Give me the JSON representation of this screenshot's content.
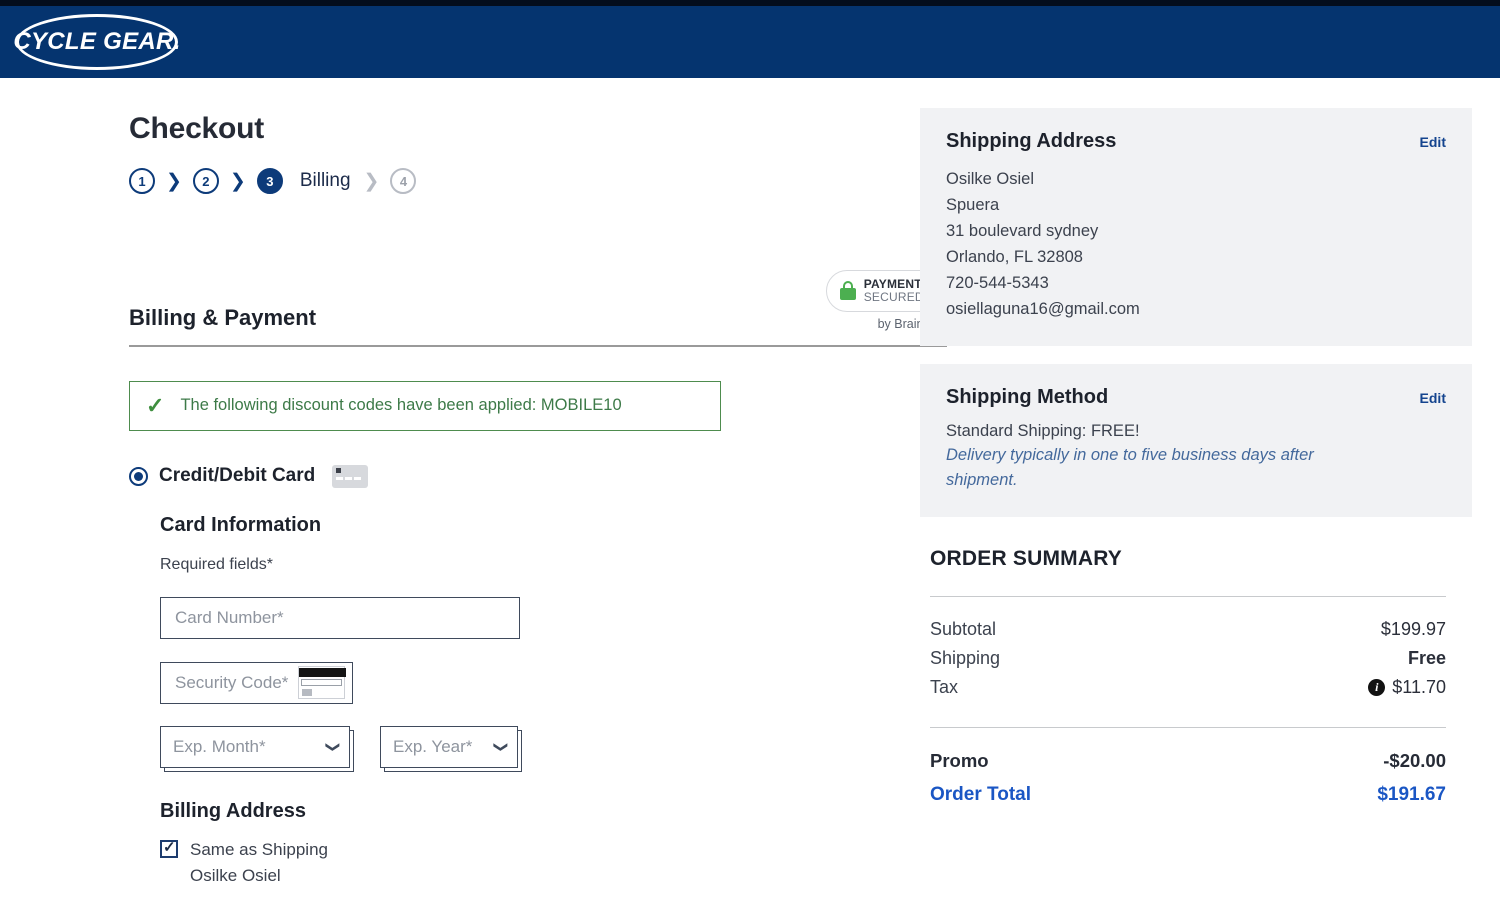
{
  "brand": {
    "logo_text": "CYCLE GEAR.",
    "header_color": "#05346f",
    "accent_navy": "#0d3b7a",
    "total_blue": "#1a56c4",
    "success_green": "#3d7a48"
  },
  "page_title": "Checkout",
  "steps": [
    {
      "number": "1",
      "label": "",
      "state": "done"
    },
    {
      "number": "2",
      "label": "",
      "state": "done"
    },
    {
      "number": "3",
      "label": "Billing",
      "state": "active"
    },
    {
      "number": "4",
      "label": "",
      "state": "inactive"
    }
  ],
  "billing_section": {
    "title": "Billing & Payment",
    "secure_badge": {
      "line1": "PAYMENTS",
      "line2": "SECURED",
      "provider": "by Braintree"
    },
    "discount_message": "The following discount codes have been applied: MOBILE10",
    "payment_method": {
      "label": "Credit/Debit Card",
      "selected": true
    },
    "card_information": {
      "heading": "Card Information",
      "required_note": "Required fields*",
      "card_number_placeholder": "Card Number*",
      "card_number_value": "",
      "security_code_placeholder": "Security Code*",
      "security_code_value": "",
      "exp_month_value": "Exp. Month*",
      "exp_year_value": "Exp. Year*"
    },
    "billing_address": {
      "heading": "Billing Address",
      "same_as_shipping_label": "Same as Shipping",
      "same_as_shipping_checked": true,
      "name": "Osilke Osiel"
    }
  },
  "sidebar": {
    "shipping_address": {
      "title": "Shipping Address",
      "edit_label": "Edit",
      "name": "Osilke Osiel",
      "company": "Spuera",
      "street": "31 boulevard sydney",
      "city_state_zip": "Orlando, FL 32808",
      "phone": "720-544-5343",
      "email": "osiellaguna16@gmail.com"
    },
    "shipping_method": {
      "title": "Shipping Method",
      "edit_label": "Edit",
      "method": "Standard Shipping: FREE!",
      "note": "Delivery typically in one to five business days after shipment."
    },
    "order_summary": {
      "title": "ORDER SUMMARY",
      "rows": [
        {
          "label": "Subtotal",
          "value": "$199.97"
        },
        {
          "label": "Shipping",
          "value": "Free"
        },
        {
          "label": "Tax",
          "value": "$11.70"
        }
      ],
      "promo_label": "Promo",
      "promo_value": "-$20.00",
      "total_label": "Order Total",
      "total_value": "$191.67"
    }
  }
}
